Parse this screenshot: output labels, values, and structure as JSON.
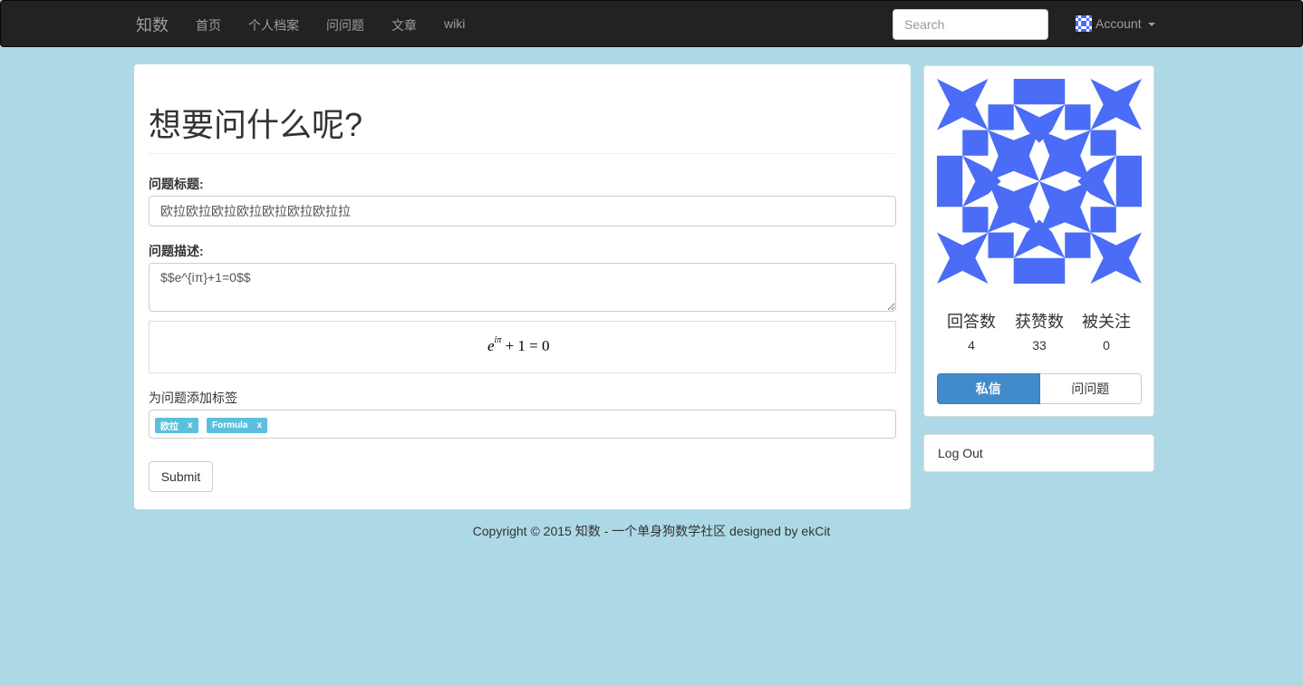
{
  "navbar": {
    "brand": "知数",
    "links": [
      "首页",
      "个人档案",
      "问问题",
      "文章",
      "wiki"
    ],
    "search_placeholder": "Search",
    "account_label": "Account",
    "avatar_color": "#4a6cf7"
  },
  "form": {
    "heading": "想要问什么呢?",
    "title_label": "问题标题:",
    "title_value": "欧拉欧拉欧拉欧拉欧拉欧拉欧拉拉",
    "desc_label": "问题描述:",
    "desc_value": "$$e^{iπ}+1=0$$",
    "preview": {
      "base": "e",
      "exponent": "iπ",
      "rest": " + 1 = 0"
    },
    "tags_label": "为问题添加标签",
    "tags": [
      {
        "name": "欧拉",
        "remove": "x"
      },
      {
        "name": "Formula",
        "remove": "x"
      }
    ],
    "submit_label": "Submit"
  },
  "profile": {
    "identicon_color": "#4a6cf7",
    "stats": [
      {
        "label": "回答数",
        "value": "4"
      },
      {
        "label": "获赞数",
        "value": "33"
      },
      {
        "label": "被关注",
        "value": "0"
      }
    ],
    "pm_label": "私信",
    "ask_label": "问问题"
  },
  "logout_label": "Log Out",
  "footer": "Copyright © 2015 知数 - 一个单身狗数学社区 designed by ekCit"
}
